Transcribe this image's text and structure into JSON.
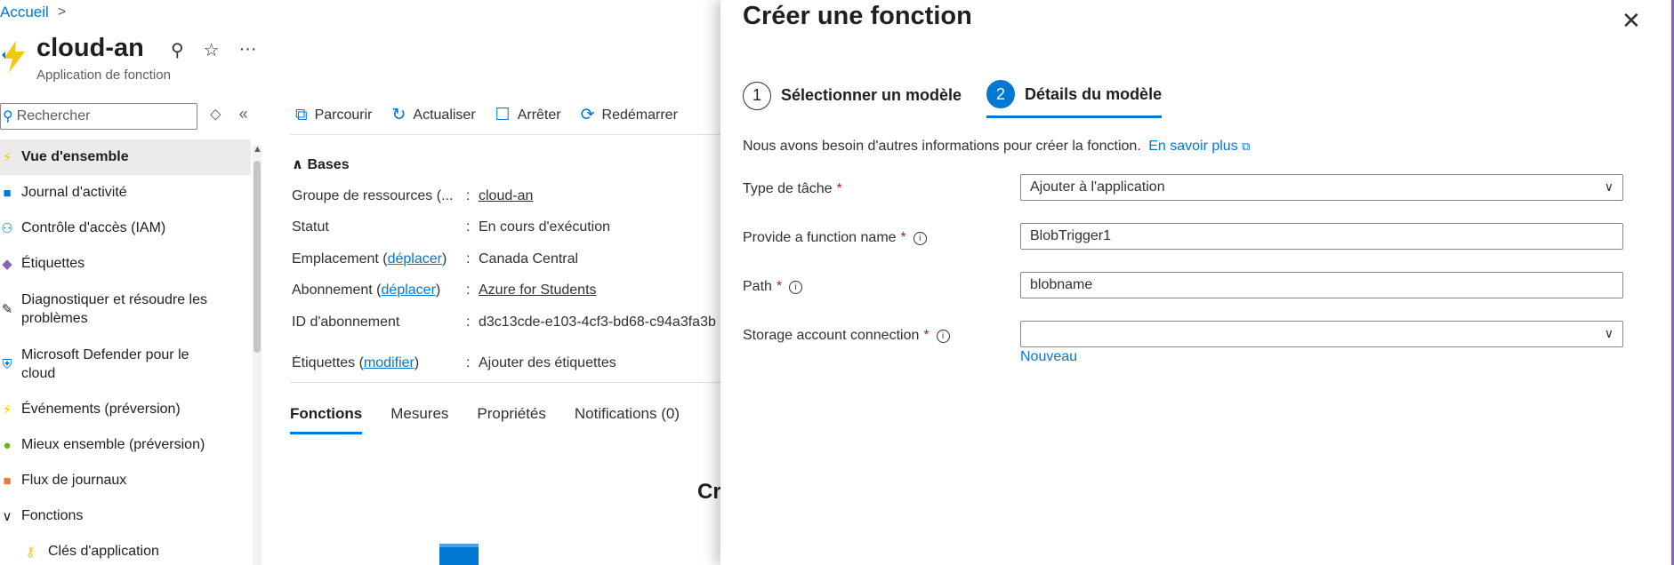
{
  "breadcrumb": {
    "home": "Accueil",
    "sep": ">"
  },
  "app": {
    "name": "cloud-an",
    "subtitle": "Application de fonction",
    "pin": "⚲",
    "star": "☆",
    "more": "···"
  },
  "search": {
    "placeholder": "Rechercher"
  },
  "nav": {
    "items": [
      {
        "label": "Vue d'ensemble",
        "icon": "⚡",
        "color": "#f2c811"
      },
      {
        "label": "Journal d'activité",
        "icon": "■",
        "color": "#0078d4"
      },
      {
        "label": "Contrôle d'accès (IAM)",
        "icon": "⚇",
        "color": "#0078d4"
      },
      {
        "label": "Étiquettes",
        "icon": "◆",
        "color": "#8764b8"
      },
      {
        "label": "Diagnostiquer et résoudre les problèmes",
        "icon": "✎",
        "color": "#323130"
      },
      {
        "label": "Microsoft Defender pour le cloud",
        "icon": "⛨",
        "color": "#0078d4"
      },
      {
        "label": "Événements (préversion)",
        "icon": "⚡",
        "color": "#f2c811"
      },
      {
        "label": "Mieux ensemble (préversion)",
        "icon": "●",
        "color": "#6bb700"
      },
      {
        "label": "Flux de journaux",
        "icon": "■",
        "color": "#e8793a"
      },
      {
        "label": "Fonctions",
        "icon": "∨",
        "color": "#323130"
      },
      {
        "label": "Clés d'application",
        "icon": "⚷",
        "color": "#f2c811"
      }
    ]
  },
  "toolbar": {
    "browse": "Parcourir",
    "refresh": "Actualiser",
    "stop": "Arrêter",
    "restart": "Redémarrer"
  },
  "essentials": {
    "header": "Bases",
    "rows": [
      {
        "key": "Groupe de ressources (...",
        "value": "cloud-an"
      },
      {
        "key": "Statut",
        "value": "En cours d'exécution"
      },
      {
        "key_prefix": "Emplacement (",
        "key_link": "déplacer",
        "key_suffix": ")",
        "value": "Canada Central"
      },
      {
        "key_prefix": "Abonnement (",
        "key_link": "déplacer",
        "key_suffix": ")",
        "value": "Azure for Students"
      },
      {
        "key": "ID d'abonnement",
        "value": "d3c13cde-e103-4cf3-bd68-c94a3fa3b"
      },
      {
        "key_prefix": "Étiquettes (",
        "key_link": "modifier",
        "key_suffix": ")",
        "value": "Ajouter des étiquettes"
      }
    ]
  },
  "tabs": [
    "Fonctions",
    "Mesures",
    "Propriétés",
    "Notifications (0)"
  ],
  "background_heading": "Cre",
  "panel": {
    "title": "Créer une fonction",
    "close": "✕",
    "steps": [
      {
        "num": "1",
        "label": "Sélectionner un modèle"
      },
      {
        "num": "2",
        "label": "Détails du modèle"
      }
    ],
    "info": "Nous avons besoin d'autres informations pour créer la fonction.",
    "learn_more": "En savoir plus",
    "fields": {
      "task_type": {
        "label": "Type de tâche",
        "value": "Ajouter à l'application"
      },
      "function_name": {
        "label": "Provide a function name",
        "value": "BlobTrigger1"
      },
      "path": {
        "label": "Path",
        "value": "blobname"
      },
      "storage": {
        "label": "Storage account connection",
        "value": ""
      }
    },
    "new_link": "Nouveau"
  }
}
